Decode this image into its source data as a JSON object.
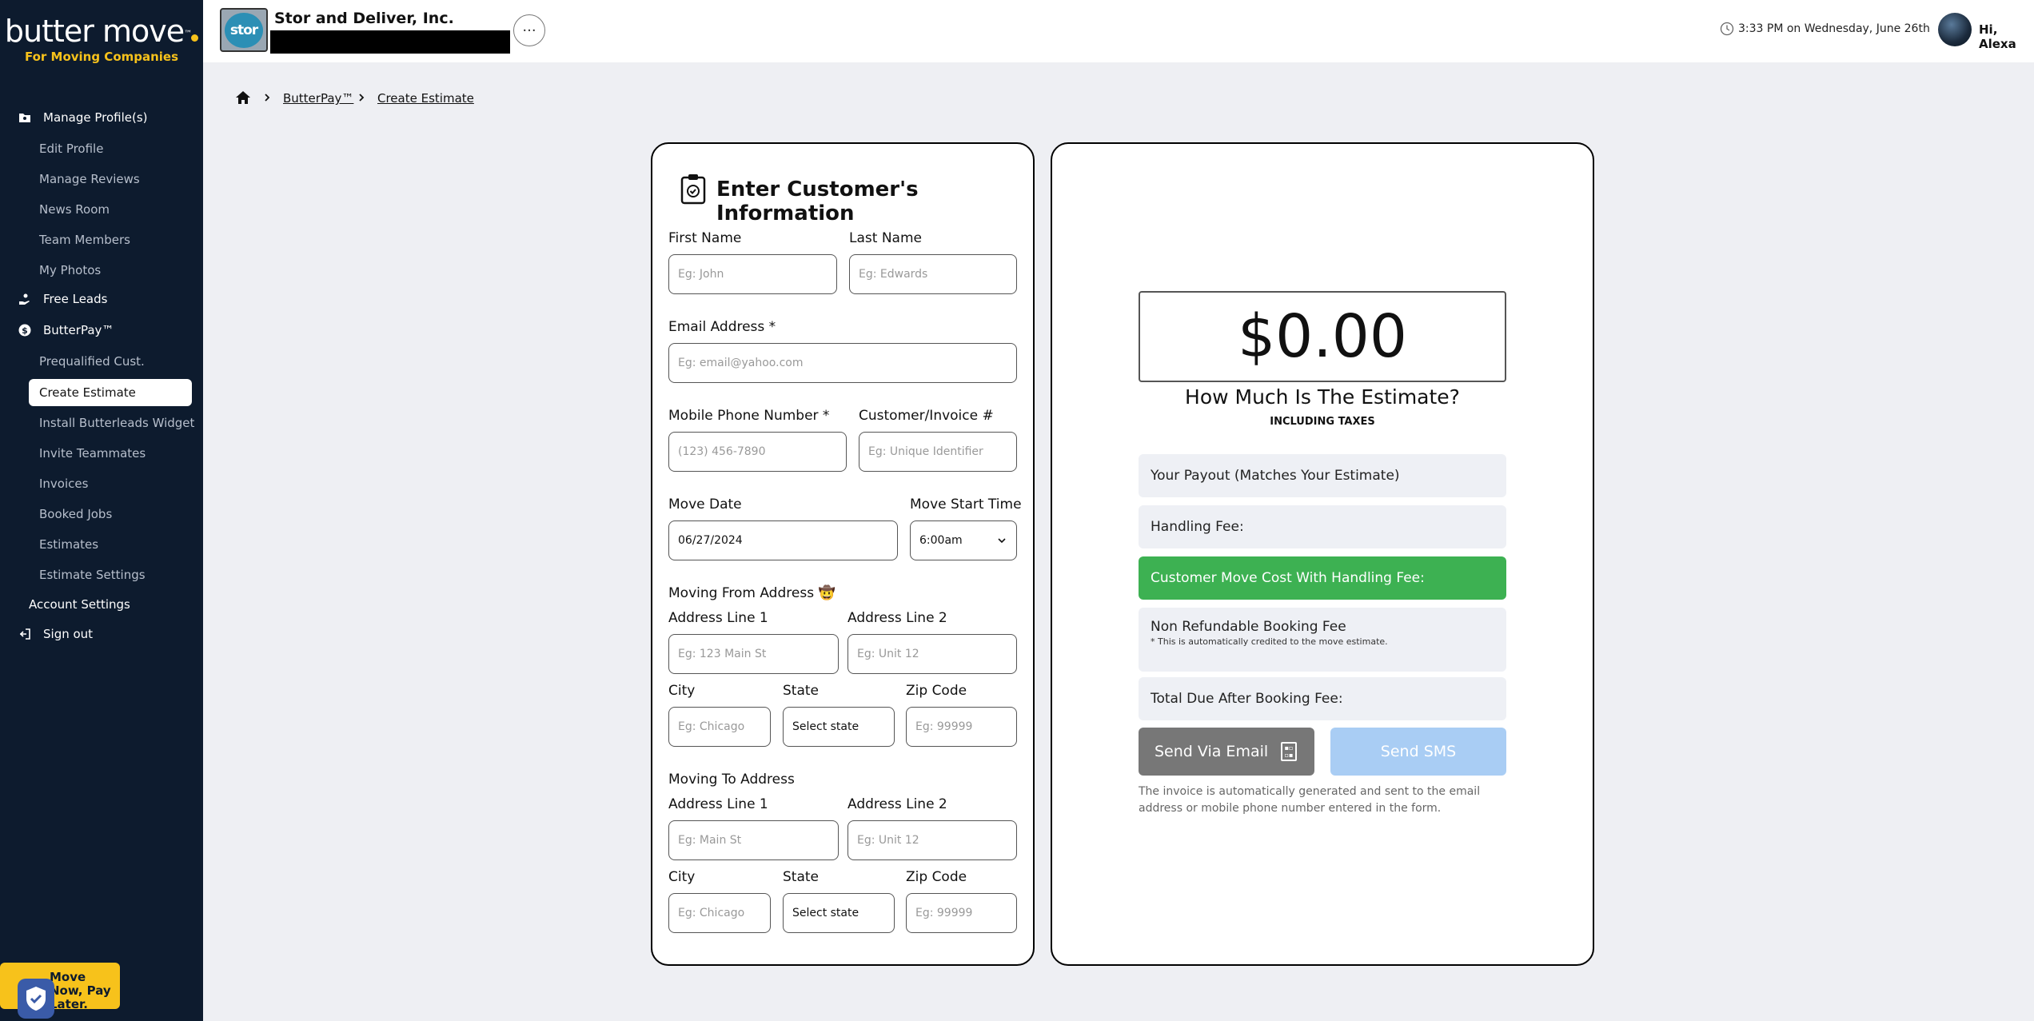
{
  "sidebar": {
    "logo_word": "butter move",
    "logo_tm": "™",
    "logo_sub": "For Moving Companies",
    "manage_profiles": "Manage Profile(s)",
    "profile_items": [
      "Edit Profile",
      "Manage Reviews",
      "News Room",
      "Team Members",
      "My Photos"
    ],
    "free_leads": "Free Leads",
    "butterpay": "ButterPay™",
    "butterpay_items": [
      "Prequalified Cust.",
      "Create Estimate",
      "Install Butterleads Widget",
      "Invite Teammates",
      "Invoices",
      "Booked Jobs",
      "Estimates",
      "Estimate Settings"
    ],
    "account_settings": "Account Settings",
    "sign_out": "Sign out",
    "promo": "Move Now, Pay Later."
  },
  "topbar": {
    "company_logo_text": "stor",
    "company_name": "Stor and Deliver, Inc.",
    "more": "···",
    "time": "3:33 PM on Wednesday, June 26th",
    "greeting": "Hi, Alexa"
  },
  "breadcrumb": [
    "ButterPay™",
    "Create Estimate"
  ],
  "form": {
    "title": "Enter Customer's Information",
    "first_name": {
      "label": "First Name",
      "placeholder": "Eg: John"
    },
    "last_name": {
      "label": "Last Name",
      "placeholder": "Eg: Edwards"
    },
    "email": {
      "label": "Email Address *",
      "placeholder": "Eg: email@yahoo.com"
    },
    "phone": {
      "label": "Mobile Phone Number *",
      "placeholder": "(123) 456-7890"
    },
    "invoice": {
      "label": "Customer/Invoice #",
      "placeholder": "Eg: Unique Identifier"
    },
    "move_date": {
      "label": "Move Date",
      "value": "06/27/2024"
    },
    "move_time": {
      "label": "Move Start Time",
      "value": "6:00am"
    },
    "from": {
      "heading": "Moving From Address 🤠",
      "addr1": {
        "label": "Address Line 1",
        "placeholder": "Eg: 123 Main St"
      },
      "addr2": {
        "label": "Address Line 2",
        "placeholder": "Eg: Unit 12"
      },
      "city": {
        "label": "City",
        "placeholder": "Eg: Chicago"
      },
      "state": {
        "label": "State",
        "value": "Select state"
      },
      "zip": {
        "label": "Zip Code",
        "placeholder": "Eg: 99999"
      }
    },
    "to": {
      "heading": "Moving To Address",
      "addr1": {
        "label": "Address Line 1",
        "placeholder": "Eg: Main St"
      },
      "addr2": {
        "label": "Address Line 2",
        "placeholder": "Eg: Unit 12"
      },
      "city": {
        "label": "City",
        "placeholder": "Eg: Chicago"
      },
      "state": {
        "label": "State",
        "value": "Select state"
      },
      "zip": {
        "label": "Zip Code",
        "placeholder": "Eg: 99999"
      }
    }
  },
  "estimate": {
    "amount": "$0.00",
    "question": "How Much Is The Estimate?",
    "tax_note": "INCLUDING TAXES",
    "payout": "Your Payout (Matches Your Estimate)",
    "handling_fee": "Handling Fee:",
    "customer_cost": "Customer Move Cost With Handling Fee:",
    "booking_fee": "Non Refundable Booking Fee",
    "booking_note": "* This is automatically credited to the move estimate.",
    "total_due": "Total Due After Booking Fee:",
    "send_email": "Send Via Email",
    "send_sms": "Send SMS",
    "footnote": "The invoice is automatically generated and sent to the email address or mobile phone number entered in the form.",
    "colors": {
      "green": "#3db152",
      "sms_disabled": "#a9cdf4",
      "email_btn": "#777777"
    }
  }
}
